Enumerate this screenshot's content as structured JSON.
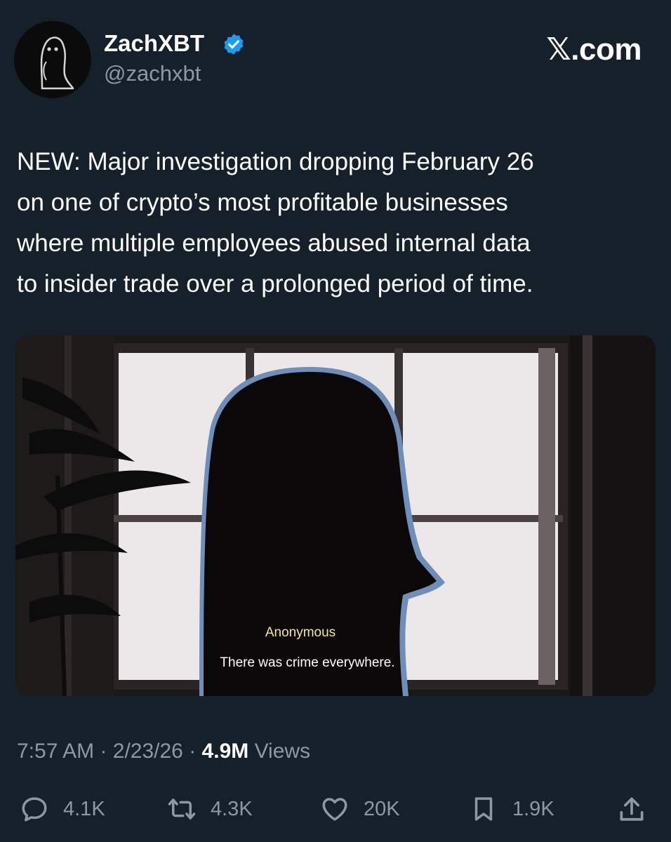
{
  "author": {
    "display_name": "ZachXBT",
    "handle": "@zachxbt",
    "verified_icon": "verified-badge-icon",
    "avatar": "ghost-avatar"
  },
  "brand": "𝕏.com",
  "post": {
    "text": "NEW: Major investigation dropping February 26\non one of crypto’s most profitable businesses\nwhere multiple employees abused internal data\nto insider trade over a prolonged period of time."
  },
  "media": {
    "caption_name": "Anonymous",
    "caption_line": "There was crime everywhere."
  },
  "meta": {
    "time": "7:57 AM",
    "separator": "·",
    "date": "2/23/26",
    "views_count": "4.9M",
    "views_label": "Views"
  },
  "actions": {
    "replies": "4.1K",
    "reposts": "4.3K",
    "likes": "20K",
    "bookmarks": "1.9K"
  },
  "colors": {
    "background": "#16202b",
    "secondary_text": "#8b98a5",
    "verified_blue": "#1d9bf0"
  }
}
